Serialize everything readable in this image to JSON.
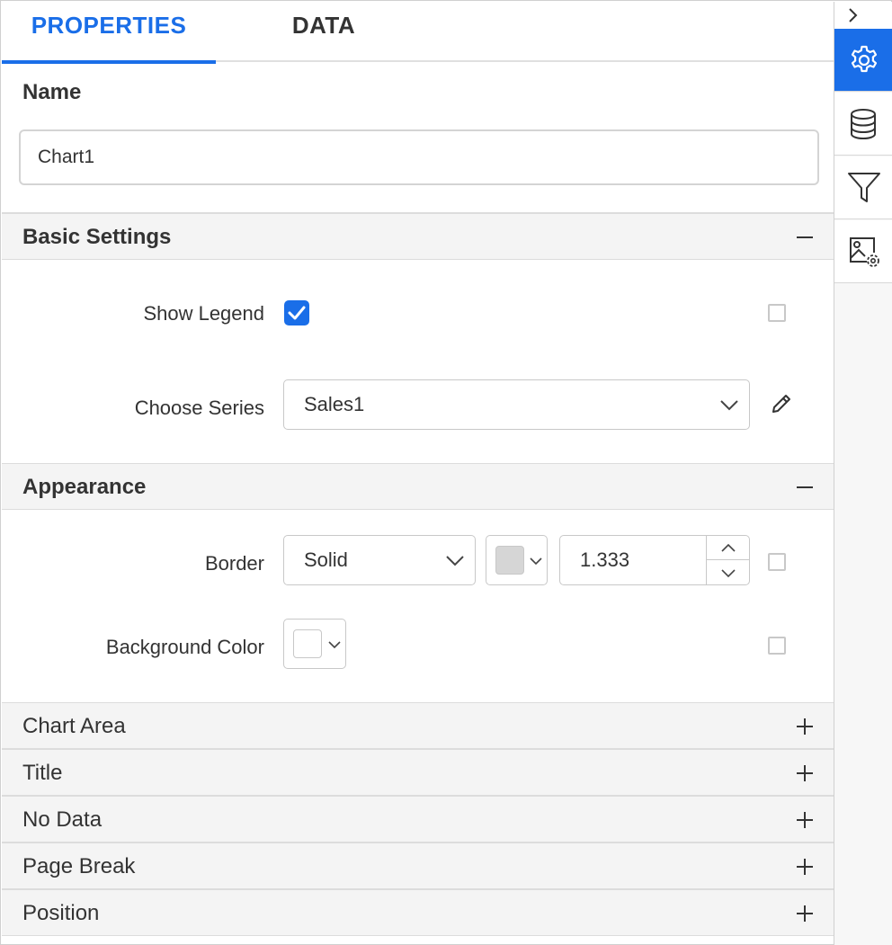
{
  "tabs": {
    "properties": "PROPERTIES",
    "data": "DATA"
  },
  "name_section": {
    "label": "Name",
    "value": "Chart1"
  },
  "basic_settings": {
    "title": "Basic Settings",
    "toggle": "collapse",
    "show_legend": {
      "label": "Show Legend",
      "checked": true
    },
    "choose_series": {
      "label": "Choose Series",
      "value": "Sales1"
    }
  },
  "appearance": {
    "title": "Appearance",
    "toggle": "collapse",
    "border": {
      "label": "Border",
      "style": "Solid",
      "color": "#d6d6d6",
      "width": "1.333"
    },
    "background_color": {
      "label": "Background Color",
      "color": "#ffffff"
    }
  },
  "collapsed_sections": [
    {
      "title": "Chart Area",
      "toggle": "expand"
    },
    {
      "title": "Title",
      "toggle": "expand"
    },
    {
      "title": "No Data",
      "toggle": "expand"
    },
    {
      "title": "Page Break",
      "toggle": "expand"
    },
    {
      "title": "Position",
      "toggle": "expand"
    }
  ],
  "sidebar": {
    "items": [
      {
        "icon": "chevron-right-icon"
      },
      {
        "icon": "gear-icon",
        "active": true
      },
      {
        "icon": "database-icon"
      },
      {
        "icon": "filter-icon"
      },
      {
        "icon": "image-settings-icon"
      }
    ]
  },
  "colors": {
    "accent": "#1a6ee8",
    "section_header_bg": "#f4f4f4",
    "border": "#c8c8c8"
  }
}
